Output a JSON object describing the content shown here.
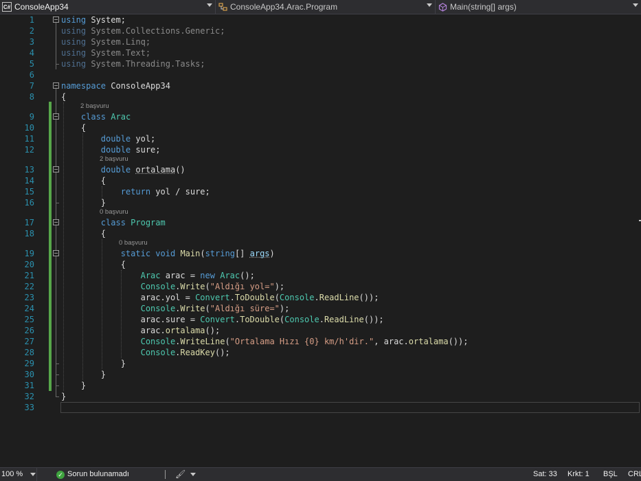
{
  "navbar": {
    "project": "ConsoleApp34",
    "type": "ConsoleApp34.Arac.Program",
    "member": "Main(string[] args)"
  },
  "icons": {
    "project": "csharp-project-icon",
    "type": "class-icon",
    "member": "method-icon",
    "ok": "check-circle-icon",
    "brush": "brush-icon"
  },
  "colors": {
    "keyword": "#569cd6",
    "type": "#4ec9b0",
    "string": "#d69d85",
    "method": "#dcdcaa",
    "line_number": "#2b91af",
    "change_bar": "#57a64a"
  },
  "codelens": {
    "class_arac": "2 başvuru",
    "method_ortalama": "2 başvuru",
    "class_program": "0 başvuru",
    "method_main": "0 başvuru"
  },
  "lines": [
    {
      "n": "1",
      "t": [
        [
          "kw",
          "using"
        ],
        [
          "p",
          " System;"
        ]
      ]
    },
    {
      "n": "2",
      "t": [
        [
          "kw",
          "using"
        ],
        [
          "p",
          " System.Collections.Generic;"
        ]
      ]
    },
    {
      "n": "3",
      "t": [
        [
          "kw",
          "using"
        ],
        [
          "p",
          " System.Linq;"
        ]
      ]
    },
    {
      "n": "4",
      "t": [
        [
          "kw",
          "using"
        ],
        [
          "p",
          " System.Text;"
        ]
      ]
    },
    {
      "n": "5",
      "t": [
        [
          "kw",
          "using"
        ],
        [
          "p",
          " System.Threading.Tasks;"
        ]
      ]
    },
    {
      "n": "6",
      "t": []
    },
    {
      "n": "7",
      "t": [
        [
          "kw",
          "namespace"
        ],
        [
          "p",
          " ConsoleApp34"
        ]
      ]
    },
    {
      "n": "8",
      "t": [
        [
          "p",
          "{"
        ]
      ]
    },
    {
      "n": "9",
      "t": [
        [
          "p",
          "    "
        ],
        [
          "kw",
          "class"
        ],
        [
          "p",
          " "
        ],
        [
          "ty",
          "Arac"
        ]
      ]
    },
    {
      "n": "10",
      "t": [
        [
          "p",
          "    {"
        ]
      ]
    },
    {
      "n": "11",
      "t": [
        [
          "p",
          "        "
        ],
        [
          "kw",
          "double"
        ],
        [
          "p",
          " yol;"
        ]
      ]
    },
    {
      "n": "12",
      "t": [
        [
          "p",
          "        "
        ],
        [
          "kw",
          "double"
        ],
        [
          "p",
          " sure;"
        ]
      ]
    },
    {
      "n": "13",
      "t": [
        [
          "p",
          "        "
        ],
        [
          "kw",
          "double"
        ],
        [
          "p",
          " "
        ],
        [
          "sq",
          "ortalama"
        ],
        [
          "p",
          "()"
        ]
      ]
    },
    {
      "n": "14",
      "t": [
        [
          "p",
          "        {"
        ]
      ]
    },
    {
      "n": "15",
      "t": [
        [
          "p",
          "            "
        ],
        [
          "kw",
          "return"
        ],
        [
          "p",
          " yol / sure;"
        ]
      ]
    },
    {
      "n": "16",
      "t": [
        [
          "p",
          "        }"
        ]
      ]
    },
    {
      "n": "17",
      "t": [
        [
          "p",
          "        "
        ],
        [
          "kw",
          "class"
        ],
        [
          "p",
          " "
        ],
        [
          "ty",
          "Program"
        ]
      ]
    },
    {
      "n": "18",
      "t": [
        [
          "p",
          "        {"
        ]
      ]
    },
    {
      "n": "19",
      "t": [
        [
          "p",
          "            "
        ],
        [
          "kw",
          "static"
        ],
        [
          "p",
          " "
        ],
        [
          "kw",
          "void"
        ],
        [
          "p",
          " "
        ],
        [
          "fn",
          "Main"
        ],
        [
          "p",
          "("
        ],
        [
          "kw",
          "string"
        ],
        [
          "p",
          "[] "
        ],
        [
          "sqv",
          "args"
        ],
        [
          "p",
          ")"
        ]
      ]
    },
    {
      "n": "20",
      "t": [
        [
          "p",
          "            {"
        ]
      ]
    },
    {
      "n": "21",
      "t": [
        [
          "p",
          "                "
        ],
        [
          "ty",
          "Arac"
        ],
        [
          "p",
          " arac = "
        ],
        [
          "kw",
          "new"
        ],
        [
          "p",
          " "
        ],
        [
          "ty",
          "Arac"
        ],
        [
          "p",
          "();"
        ]
      ]
    },
    {
      "n": "22",
      "t": [
        [
          "p",
          "                "
        ],
        [
          "ty",
          "Console"
        ],
        [
          "p",
          "."
        ],
        [
          "fn",
          "Write"
        ],
        [
          "p",
          "("
        ],
        [
          "st",
          "\"Aldığı yol=\""
        ],
        [
          "p",
          ");"
        ]
      ]
    },
    {
      "n": "23",
      "t": [
        [
          "p",
          "                arac.yol = "
        ],
        [
          "ty",
          "Convert"
        ],
        [
          "p",
          "."
        ],
        [
          "fn",
          "ToDouble"
        ],
        [
          "p",
          "("
        ],
        [
          "ty",
          "Console"
        ],
        [
          "p",
          "."
        ],
        [
          "fn",
          "ReadLine"
        ],
        [
          "p",
          "());"
        ]
      ]
    },
    {
      "n": "24",
      "t": [
        [
          "p",
          "                "
        ],
        [
          "ty",
          "Console"
        ],
        [
          "p",
          "."
        ],
        [
          "fn",
          "Write"
        ],
        [
          "p",
          "("
        ],
        [
          "st",
          "\"Aldığı süre=\""
        ],
        [
          "p",
          ");"
        ]
      ]
    },
    {
      "n": "25",
      "t": [
        [
          "p",
          "                arac.sure = "
        ],
        [
          "ty",
          "Convert"
        ],
        [
          "p",
          "."
        ],
        [
          "fn",
          "ToDouble"
        ],
        [
          "p",
          "("
        ],
        [
          "ty",
          "Console"
        ],
        [
          "p",
          "."
        ],
        [
          "fn",
          "ReadLine"
        ],
        [
          "p",
          "());"
        ]
      ]
    },
    {
      "n": "26",
      "t": [
        [
          "p",
          "                arac."
        ],
        [
          "fn",
          "ortalama"
        ],
        [
          "p",
          "();"
        ]
      ]
    },
    {
      "n": "27",
      "t": [
        [
          "p",
          "                "
        ],
        [
          "ty",
          "Console"
        ],
        [
          "p",
          "."
        ],
        [
          "fn",
          "WriteLine"
        ],
        [
          "p",
          "("
        ],
        [
          "st",
          "\"Ortalama Hızı {0} km/h'dir.\""
        ],
        [
          "p",
          ", arac."
        ],
        [
          "fn",
          "ortalama"
        ],
        [
          "p",
          "());"
        ]
      ]
    },
    {
      "n": "28",
      "t": [
        [
          "p",
          "                "
        ],
        [
          "ty",
          "Console"
        ],
        [
          "p",
          "."
        ],
        [
          "fn",
          "ReadKey"
        ],
        [
          "p",
          "();"
        ]
      ]
    },
    {
      "n": "29",
      "t": [
        [
          "p",
          "            }"
        ]
      ]
    },
    {
      "n": "30",
      "t": [
        [
          "p",
          "        }"
        ]
      ]
    },
    {
      "n": "31",
      "t": [
        [
          "p",
          "    }"
        ]
      ]
    },
    {
      "n": "32",
      "t": [
        [
          "p",
          "}"
        ]
      ]
    },
    {
      "n": "33",
      "t": []
    }
  ],
  "statusbar": {
    "zoom": "100 %",
    "status": "Sorun bulunamadı",
    "line": "Sat: 33",
    "char": "Krkt: 1",
    "insert": "BŞL",
    "ending": "CRLF"
  }
}
